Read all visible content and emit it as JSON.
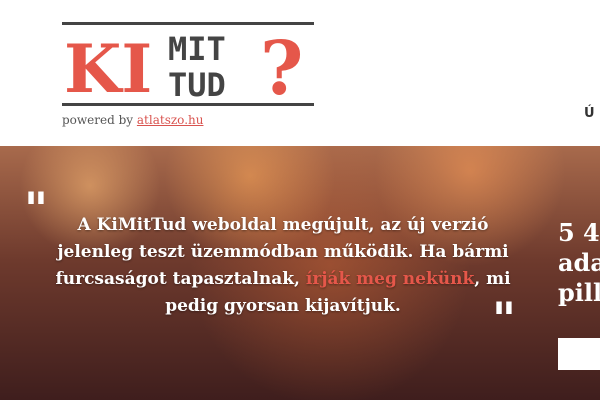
{
  "logo": {
    "ki": "KI",
    "mit": "MIT",
    "tud": "TUD",
    "question": "?",
    "colors": {
      "red": "#e5574a",
      "dark": "#333333"
    }
  },
  "powered": {
    "prefix": "powered by",
    "link": "atlatszo.hu"
  },
  "nav": {
    "peek_label": "Ú"
  },
  "hero": {
    "notice": {
      "part1": "A KiMitTud weboldal megújult, az új verzió jelenleg teszt üzemmódban működik. Ha bármi furcsaságot tapasztalnak,",
      "link": "írják meg nekünk",
      "part2": ", mi pedig gyorsan kijavítjuk."
    },
    "quote_open": "\"",
    "quote_close": "\"",
    "stats": {
      "line1": "5 4",
      "line2": "ada",
      "line3": "pill"
    }
  }
}
